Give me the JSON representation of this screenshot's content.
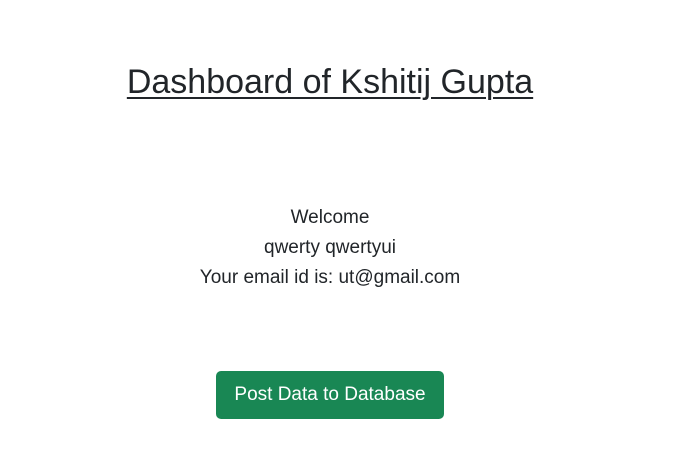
{
  "header": {
    "title": "Dashboard of Kshitij Gupta"
  },
  "main": {
    "welcome_label": "Welcome",
    "user_name": "qwerty qwertyui",
    "email_line": "Your email id is: ut@gmail.com"
  },
  "actions": {
    "post_button_label": "Post Data to Database",
    "post_button_color": "#198754"
  }
}
